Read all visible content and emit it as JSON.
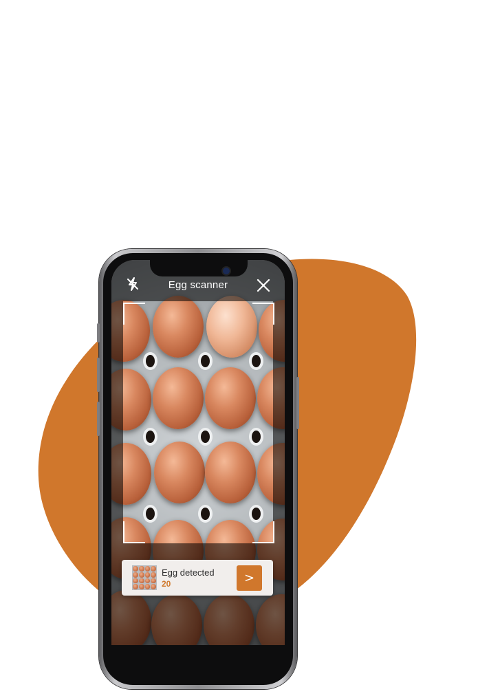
{
  "header": {
    "title": "Egg scanner"
  },
  "result_card": {
    "label": "Egg detected",
    "count": "20",
    "next_label": ">"
  },
  "icons": {
    "flash": "flash-off-icon",
    "close": "close-icon",
    "next": "chevron-right-icon"
  },
  "colors": {
    "accent": "#d0772c",
    "blob": "#d0772c",
    "card_bg": "#f1eeec",
    "count_text": "#d07a2d"
  }
}
